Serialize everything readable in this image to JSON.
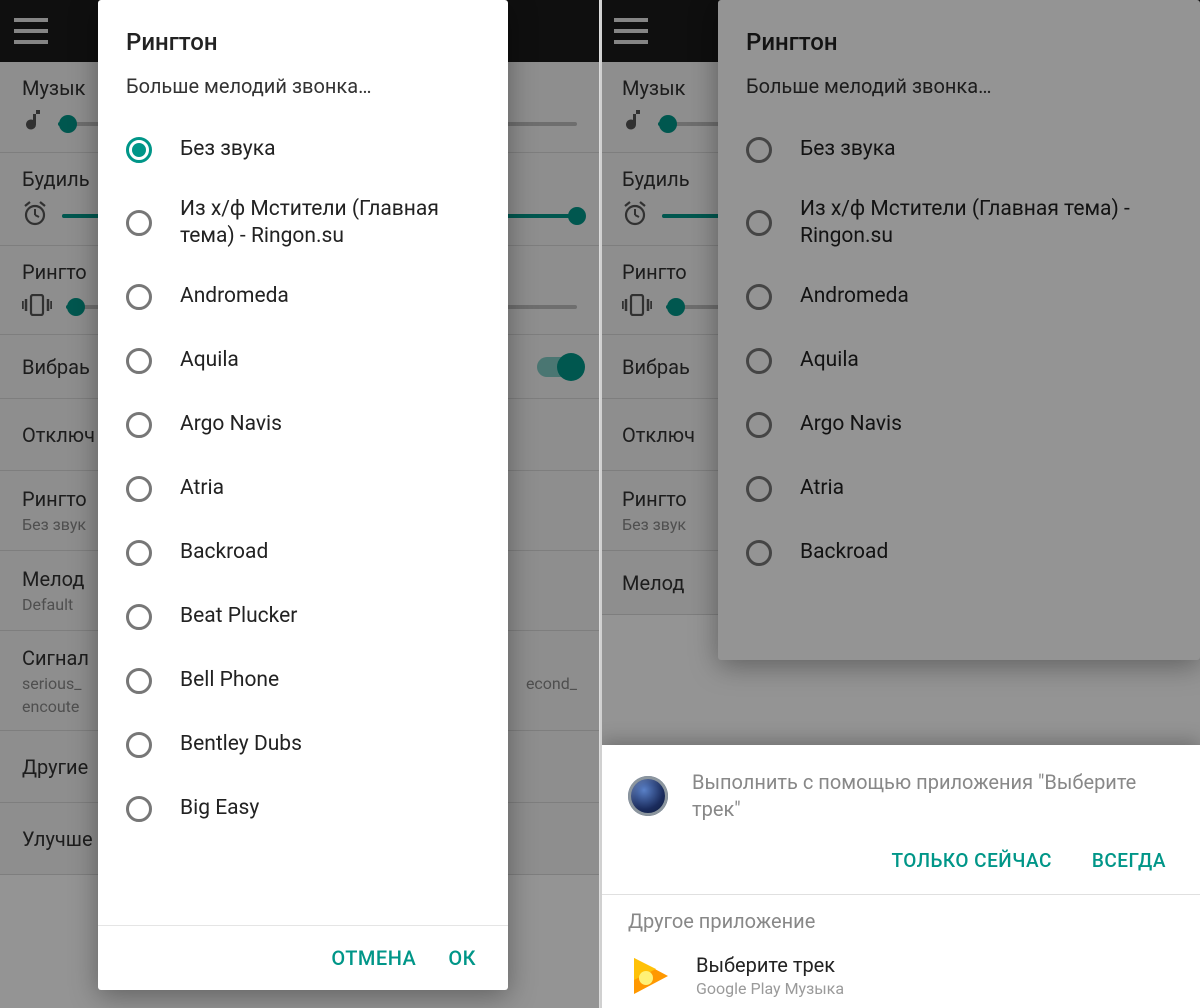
{
  "colors": {
    "accent": "#009688"
  },
  "settings": {
    "music": "Музык",
    "alarm": "Будиль",
    "ringtone": "Рингто",
    "vibration": "Вибраь",
    "disable": "Отключ",
    "ringtone2": "Рингто",
    "ringtone2_sub": "Без звук",
    "melody": "Мелод",
    "melody_sub": "Default",
    "signal": "Сигнал",
    "signal_sub1": "serious_",
    "signal_sub1b": "econd_",
    "signal_sub2": "encoute",
    "other": "Другие",
    "improve": "Улучше"
  },
  "dialog": {
    "title": "Рингтон",
    "subtitle": "Больше мелодий звонка…",
    "cancel": "ОТМЕНА",
    "ok": "ОК",
    "options_left": [
      {
        "label": "Без звука",
        "selected": true
      },
      {
        "label": "Из х/ф Мстители (Главная тема) - Ringon.su",
        "selected": false
      },
      {
        "label": "Andromeda",
        "selected": false
      },
      {
        "label": "Aquila",
        "selected": false
      },
      {
        "label": "Argo Navis",
        "selected": false
      },
      {
        "label": "Atria",
        "selected": false
      },
      {
        "label": "Backroad",
        "selected": false
      },
      {
        "label": "Beat Plucker",
        "selected": false
      },
      {
        "label": "Bell Phone",
        "selected": false
      },
      {
        "label": "Bentley Dubs",
        "selected": false
      },
      {
        "label": "Big Easy",
        "selected": false
      }
    ],
    "options_right": [
      {
        "label": "Без звука",
        "selected": false
      },
      {
        "label": "Из х/ф Мстители (Главная тема) - Ringon.su",
        "selected": false
      },
      {
        "label": "Andromeda",
        "selected": false
      },
      {
        "label": "Aquila",
        "selected": false
      },
      {
        "label": "Argo Navis",
        "selected": false
      },
      {
        "label": "Atria",
        "selected": false
      },
      {
        "label": "Backroad",
        "selected": false
      }
    ]
  },
  "chooser": {
    "title": "Выполнить с помощью приложения \"Выберите трек\"",
    "just_once": "ТОЛЬКО СЕЙЧАС",
    "always": "ВСЕГДА",
    "alt_label": "Другое приложение",
    "app_name": "Выберите трек",
    "app_sub": "Google Play Музыка"
  }
}
